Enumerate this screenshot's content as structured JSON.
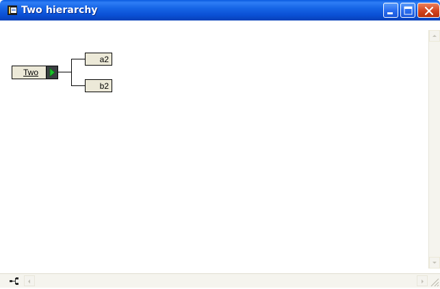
{
  "window": {
    "title": "Two hierarchy"
  },
  "hierarchy": {
    "root": {
      "label": "Two"
    },
    "children": [
      {
        "label": "a2"
      },
      {
        "label": "b2"
      }
    ]
  },
  "icons": {
    "app": "document-icon",
    "minimize": "minimize-icon",
    "maximize": "maximize-icon",
    "close": "close-icon",
    "expand": "triangle-right-icon",
    "hierarchy_view": "hierarchy-icon"
  },
  "colors": {
    "titlebar": "#0a4fd4",
    "node_fill": "#ece9d8",
    "expand_arrow": "#19c12b",
    "close_button": "#d2441f"
  }
}
